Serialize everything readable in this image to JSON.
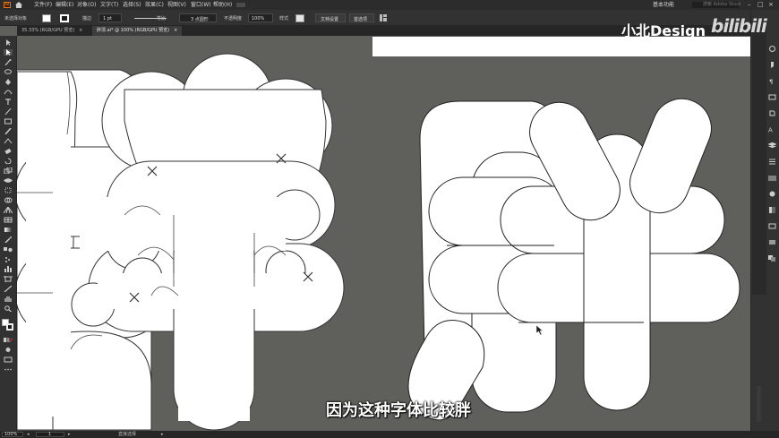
{
  "menubar": {
    "items": [
      "文件(F)",
      "编辑(E)",
      "对象(O)",
      "文字(T)",
      "选择(S)",
      "效果(C)",
      "视图(V)",
      "窗口(W)",
      "帮助(H)"
    ],
    "workspace": "基本功能",
    "search_placeholder": "搜索 Adobe Stock"
  },
  "control_bar": {
    "selection_label": "未选择对象",
    "stroke_label": "描边",
    "stroke_value": "1 pt",
    "profile_label": "等比",
    "brush_value": "3 点圆形",
    "opacity_label": "不透明度",
    "opacity_value": "100%",
    "style_label": "样式",
    "doc_setup_button": "文档设置",
    "preferences_button": "首选项"
  },
  "tabs": [
    {
      "label": "35.33% (RGB/GPU 预览)",
      "active": false
    },
    {
      "label": "胖漂.ai* @ 100% (RGB/GPU 预览)",
      "active": true
    }
  ],
  "status": {
    "zoom": "100%",
    "page": "1",
    "tool_name": "直接选择"
  },
  "watermark": {
    "channel": "小北Design",
    "platform": "bilibili"
  },
  "subtitle": "因为这种字体比较胖",
  "colors": {
    "canvas": "#5f5f5b",
    "panel": "#323232",
    "menubar": "#2c2c2c",
    "shape_fill": "#ffffff",
    "shape_stroke": "#222222",
    "accent": "#e07b1e"
  }
}
